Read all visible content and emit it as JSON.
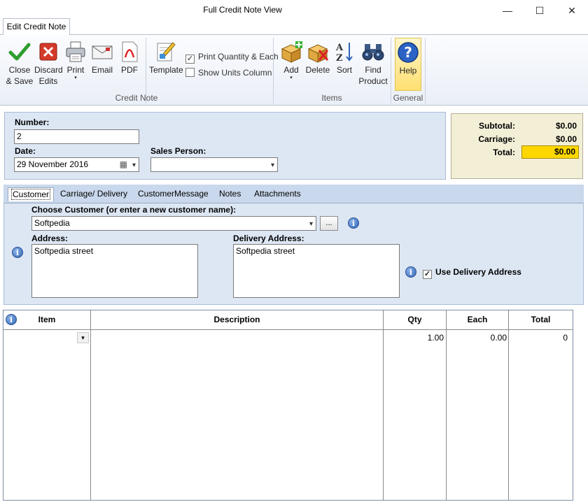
{
  "window": {
    "title": "Full Credit Note View",
    "minimize": "—",
    "maximize": "☐",
    "close": "✕"
  },
  "ribbon": {
    "tab": "Edit Credit Note",
    "credit_note_group": "Credit Note",
    "items_group": "Items",
    "general_group": "General",
    "close_save": [
      "Close",
      "& Save"
    ],
    "discard": [
      "Discard",
      "Edits"
    ],
    "print": "Print",
    "email": "Email",
    "pdf": "PDF",
    "template": "Template",
    "print_qty": {
      "label": "Print Quantity & Each",
      "checked": "✓"
    },
    "show_units": {
      "label": "Show Units Column",
      "checked": ""
    },
    "add": "Add",
    "delete": "Delete",
    "sort": "Sort",
    "find_product": [
      "Find",
      "Product"
    ],
    "help": "Help"
  },
  "header": {
    "number_label": "Number:",
    "number_value": "2",
    "date_label": "Date:",
    "date_value": "29 November  2016",
    "sales_label": "Sales Person:",
    "sales_value": ""
  },
  "totals": {
    "subtotal_label": "Subtotal:",
    "subtotal": "$0.00",
    "carriage_label": "Carriage:",
    "carriage": "$0.00",
    "total_label": "Total:",
    "total": "$0.00",
    "highlight": "#ffd700"
  },
  "tabs": [
    "Customer",
    "Carriage/ Delivery",
    "CustomerMessage",
    "Notes",
    "Attachments"
  ],
  "customer": {
    "choose_label": "Choose Customer (or enter a new customer name):",
    "customer_value": "Softpedia",
    "ellipsis": "...",
    "address_label": "Address:",
    "address_value": "Softpedia street",
    "delivery_label": "Delivery Address:",
    "delivery_value": "Softpedia street",
    "use_delivery_label": "Use Delivery Address",
    "use_delivery_checked": "✓"
  },
  "grid": {
    "headers": [
      "Item",
      "Description",
      "Qty",
      "Each",
      "Total"
    ],
    "rows": [
      {
        "item": "",
        "description": "",
        "qty": "1.00",
        "each": "0.00",
        "total": "0"
      }
    ]
  },
  "icons": {
    "info": "i",
    "dropdown": "▾",
    "calendar": "▦"
  },
  "colors": {
    "accent_blue": "#2f64b7",
    "panel_bg": "#dde7f4",
    "totals_bg": "#f3efd7"
  }
}
